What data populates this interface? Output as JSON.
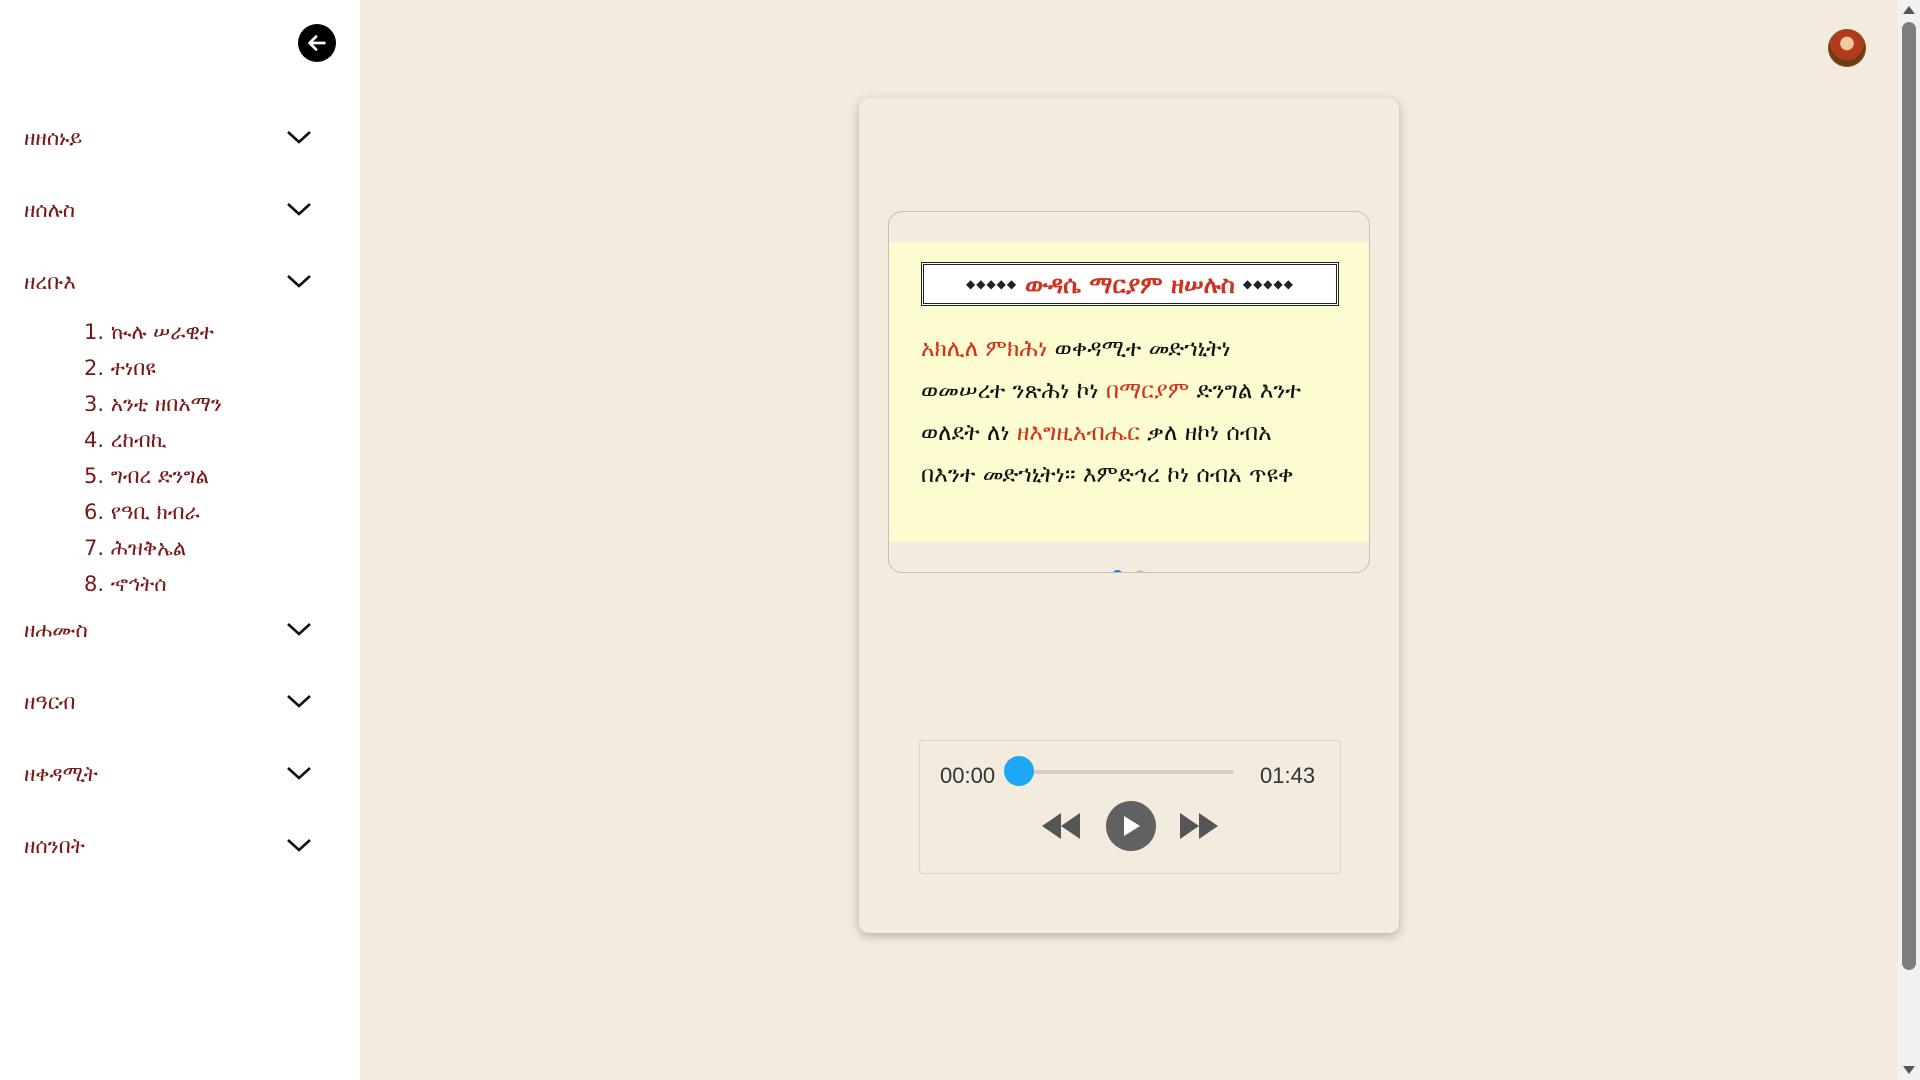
{
  "sidebar": {
    "back_icon": "arrow-left-icon",
    "items": [
      {
        "label": "ዘዘሰኑይ"
      },
      {
        "label": "ዘሰሉስ"
      },
      {
        "label": "ዘረቡእ",
        "expanded": true,
        "subitems": [
          "1. ኲሉ ሠራዊተ",
          "2. ተነበዩ",
          "3. አንቲ ዘበአማን",
          "4. ረከብኪ",
          "5. ግብረ ድንግል",
          "6. የዓቢ ክብራ",
          "7. ሕዝቅኤል",
          "8. ኆኅትሰ"
        ]
      },
      {
        "label": "ዘሐሙስ"
      },
      {
        "label": "ዘዓርብ"
      },
      {
        "label": "ዘቀዳሚት"
      },
      {
        "label": "ዘሰንበት"
      }
    ]
  },
  "slide": {
    "title": "ውዳሴ ማርያም ዘሠሉስ",
    "line1_a": "አክሊለ ምክሕነ",
    "line1_b": " ወቀዳሚተ መድኀኒትነ",
    "line2_a": "ወመሠረተ ንጽሕነ ኮነ ",
    "line2_b": "በማርያም",
    "line2_c": " ድንግል እንተ",
    "line3_a": "ወለደት ለነ ",
    "line3_b": "ዘእግዚአብሔር",
    "line3_c": " ቃለ ዘኮነ ሰብአ",
    "line4": "በእንተ መድኀኒትነ፡፡ እምድኅረ ኮነ ሰብአ ጥዩቀ",
    "dots": 2,
    "active_dot": 0
  },
  "player": {
    "current_time": "00:00",
    "duration": "01:43",
    "progress": 0,
    "rewind_icon": "rewind-icon",
    "play_icon": "play-icon",
    "forward_icon": "fast-forward-icon"
  },
  "colors": {
    "accent_red": "#d2311f",
    "nav_text": "#7a1717",
    "thumb_blue": "#1ea7f5",
    "dot_active": "#1a7ef0",
    "background": "#f2ebde"
  }
}
